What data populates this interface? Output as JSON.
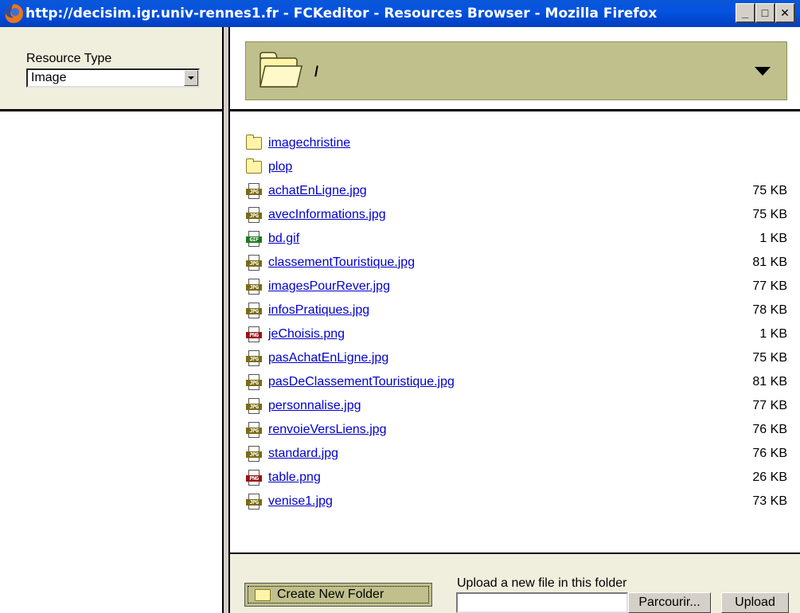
{
  "window": {
    "title": "http://decisim.igr.univ-rennes1.fr - FCKeditor - Resources Browser - Mozilla Firefox",
    "minimize_glyph": "_",
    "maximize_glyph": "□",
    "close_glyph": "✕"
  },
  "resource_type": {
    "label": "Resource Type",
    "selected": "Image"
  },
  "path_bar": {
    "current_path": "/"
  },
  "files": [
    {
      "name": "imagechristine",
      "type": "folder",
      "size": ""
    },
    {
      "name": "plop",
      "type": "folder",
      "size": ""
    },
    {
      "name": "achatEnLigne.jpg",
      "type": "jpg",
      "size": "75 KB"
    },
    {
      "name": "avecInformations.jpg",
      "type": "jpg",
      "size": "75 KB"
    },
    {
      "name": "bd.gif",
      "type": "gif",
      "size": "1 KB"
    },
    {
      "name": "classementTouristique.jpg",
      "type": "jpg",
      "size": "81 KB"
    },
    {
      "name": "imagesPourRever.jpg",
      "type": "jpg",
      "size": "77 KB"
    },
    {
      "name": "infosPratiques.jpg",
      "type": "jpg",
      "size": "78 KB"
    },
    {
      "name": "jeChoisis.png",
      "type": "png",
      "size": "1 KB"
    },
    {
      "name": "pasAchatEnLigne.jpg",
      "type": "jpg",
      "size": "75 KB"
    },
    {
      "name": "pasDeClassementTouristique.jpg",
      "type": "jpg",
      "size": "81 KB"
    },
    {
      "name": "personnalise.jpg",
      "type": "jpg",
      "size": "77 KB"
    },
    {
      "name": "renvoieVersLiens.jpg",
      "type": "jpg",
      "size": "76 KB"
    },
    {
      "name": "standard.jpg",
      "type": "jpg",
      "size": "76 KB"
    },
    {
      "name": "table.png",
      "type": "png",
      "size": "26 KB"
    },
    {
      "name": "venise1.jpg",
      "type": "jpg",
      "size": "73 KB"
    }
  ],
  "icon_tags": {
    "jpg": "JPG",
    "gif": "GIF",
    "png": "PNG"
  },
  "bottom": {
    "create_folder_label": "Create New Folder",
    "upload_label": "Upload a new file in this folder",
    "upload_value": "",
    "browse_label": "Parcourir...",
    "upload_button_label": "Upload"
  },
  "colors": {
    "titlebar": "#0453e1",
    "panel_bg": "#f0eedd",
    "path_bar": "#c0c08c",
    "link": "#0000cc"
  }
}
